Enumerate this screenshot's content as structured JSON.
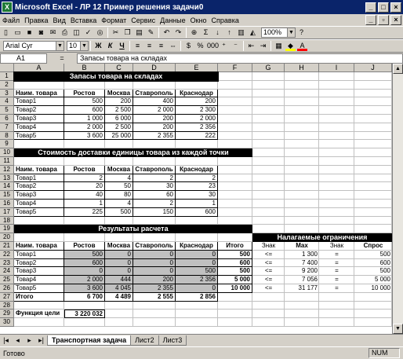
{
  "app": {
    "title": "Microsoft Excel - ЛР 12 Пример решения задачи0",
    "icon": "X"
  },
  "menu": [
    "Файл",
    "Правка",
    "Вид",
    "Вставка",
    "Формат",
    "Сервис",
    "Данные",
    "Окно",
    "Справка"
  ],
  "toolbar": {
    "font": "Arial Cyr",
    "size": "10",
    "zoom": "100%",
    "bold": "Ж",
    "italic": "К",
    "underline": "Ч"
  },
  "formula": {
    "cell_ref": "A1",
    "fx": "=",
    "content": "Запасы товара на складах"
  },
  "columns": [
    "A",
    "B",
    "C",
    "D",
    "E",
    "F",
    "G",
    "H",
    "I",
    "J"
  ],
  "rows": [
    "1",
    "2",
    "3",
    "4",
    "5",
    "6",
    "7",
    "8",
    "9",
    "10",
    "11",
    "12",
    "13",
    "14",
    "15",
    "16",
    "17",
    "18",
    "19",
    "20",
    "21",
    "22",
    "23",
    "24",
    "25",
    "26",
    "27",
    "28",
    "29",
    "30"
  ],
  "sheet": {
    "t1_title": "Запасы товара на складах",
    "t1_header": [
      "Наим. товара",
      "Ростов",
      "Москва",
      "Ставрополь",
      "Краснодар"
    ],
    "t1_rows": [
      [
        "Товар1",
        "500",
        "200",
        "400",
        "200"
      ],
      [
        "Товар2",
        "600",
        "2 500",
        "2 000",
        "2 300"
      ],
      [
        "Товар3",
        "1 000",
        "6 000",
        "200",
        "2 000"
      ],
      [
        "Товар4",
        "2 000",
        "2 500",
        "200",
        "2 356"
      ],
      [
        "Товар5",
        "3 600",
        "25 000",
        "2 355",
        "222"
      ]
    ],
    "t2_title": "Стоимость доставки единицы товара из каждой точки",
    "t2_header": [
      "Наим. товара",
      "Ростов",
      "Москва",
      "Ставрополь",
      "Краснодар"
    ],
    "t2_rows": [
      [
        "Товар1",
        "2",
        "4",
        "2",
        "2"
      ],
      [
        "Товар2",
        "20",
        "50",
        "30",
        "23"
      ],
      [
        "Товар3",
        "40",
        "80",
        "60",
        "30"
      ],
      [
        "Товар4",
        "1",
        "4",
        "2",
        "1"
      ],
      [
        "Товар5",
        "225",
        "500",
        "150",
        "600"
      ]
    ],
    "t3_title": "Результаты расчета",
    "t3_header": [
      "Наим. товара",
      "Ростов",
      "Москва",
      "Ставрополь",
      "Краснодар",
      "Итого"
    ],
    "t3_rows": [
      [
        "Товар1",
        "500",
        "0",
        "0",
        "0",
        "500"
      ],
      [
        "Товар2",
        "600",
        "0",
        "0",
        "0",
        "600"
      ],
      [
        "Товар3",
        "0",
        "0",
        "0",
        "500",
        "500"
      ],
      [
        "Товар4",
        "2 000",
        "444",
        "200",
        "2 356",
        "5 000"
      ],
      [
        "Товар5",
        "3 600",
        "4 045",
        "2 355",
        "0",
        "10 000"
      ]
    ],
    "t3_total": [
      "Итого",
      "6 700",
      "4 489",
      "2 555",
      "2 856"
    ],
    "c_title": "Налагаемые ограничения",
    "c_header": [
      "Знак",
      "Max",
      "Знак",
      "Спрос"
    ],
    "c_rows": [
      [
        "<=",
        "1 300",
        "=",
        "500"
      ],
      [
        "<=",
        "7 400",
        "=",
        "600"
      ],
      [
        "<=",
        "9 200",
        "=",
        "500"
      ],
      [
        "<=",
        "7 056",
        "=",
        "5 000"
      ],
      [
        "<=",
        "31 177",
        "=",
        "10 000"
      ]
    ],
    "goal_label": "Функция цели",
    "goal_value": "3 220 032"
  },
  "tabs": [
    "Транспортная задача",
    "Лист2",
    "Лист3"
  ],
  "status": {
    "text": "Готово",
    "num": "NUM"
  }
}
